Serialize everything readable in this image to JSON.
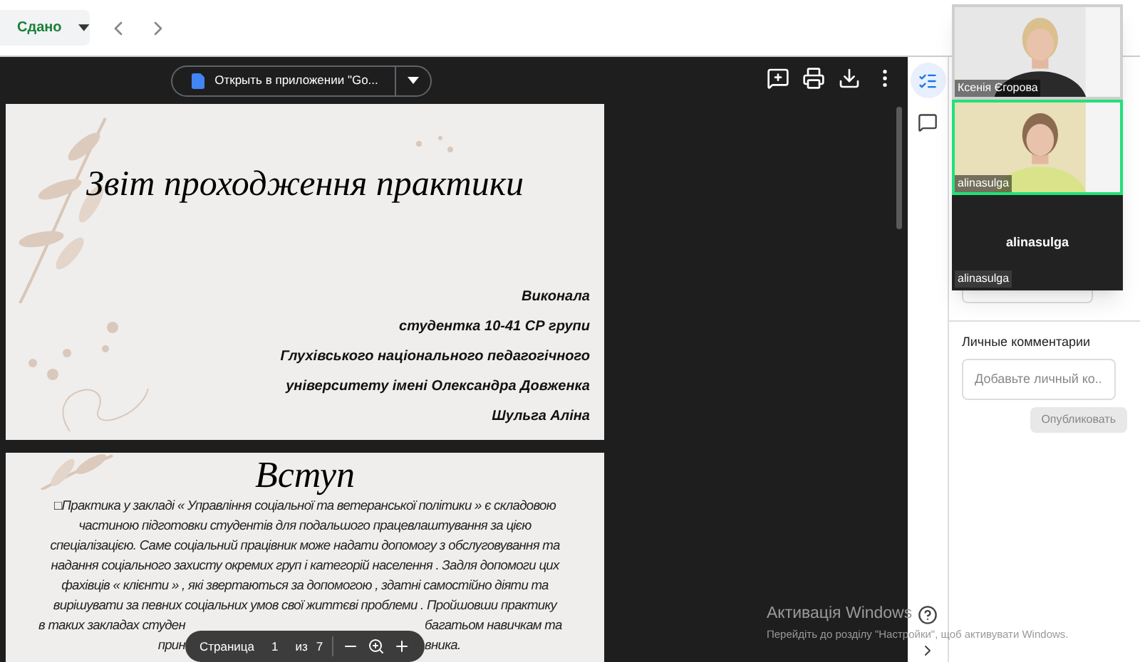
{
  "top_bar": {
    "status_button": "Сдано"
  },
  "viewer_toolbar": {
    "open_button": "Открыть в приложении \"Go..."
  },
  "pages": [
    {
      "kind": "title",
      "title": "Звіт проходження практики",
      "lines": [
        "Виконала",
        "студентка 10-41 СР групи",
        "Глухівського національного педагогічного",
        "університету імені Олександра Довженка",
        "Шульга Аліна"
      ]
    },
    {
      "kind": "text",
      "title": "Вступ",
      "lines": [
        "□Практика у закладі « Управління соціальної та ветеранської політики » є складовою",
        "частиною підготовки студентів для подальшого працевлаштування за цією",
        "спеціалізацією. Саме соціальний працівник може надати допомогу з обслуговування та",
        "надання соціального захисту окремих груп і категорій населення . Задля допомоги цих",
        "фахівців « клієнти » , які звертаються за допомогою , здатні самостійно діяти та",
        "вирішувати за певних соціальних умов свої життєві проблеми . Пройшовши практику"
      ],
      "covered_lines": [
        {
          "left": "в таких закладах  студен",
          "right": "багатьом навичкам та"
        },
        {
          "left": "прин",
          "right": "вника."
        }
      ]
    }
  ],
  "page_toolbar": {
    "page_label": "Страница",
    "page": "1",
    "of_label": "из",
    "total": "7"
  },
  "side_tabs": [
    {
      "kind": "details",
      "selected": true
    },
    {
      "kind": "comments",
      "selected": false
    }
  ],
  "private_comments": {
    "title": "Личные комментарии",
    "placeholder": "Добавьте личный ко...",
    "post_button": "Опубликовать"
  },
  "video_tiles": [
    {
      "kind": "camera",
      "name": "Ксенія Єгорова",
      "speaking": false
    },
    {
      "kind": "camera",
      "name": "alinasulga",
      "speaking": true
    },
    {
      "kind": "no_camera",
      "center_name": "alinasulga",
      "name": "alinasulga",
      "speaking": false
    }
  ],
  "os_notice": {
    "title": "Активація Windows",
    "text": "Перейдіть до розділу \"Настройки\", щоб активувати Windows."
  }
}
